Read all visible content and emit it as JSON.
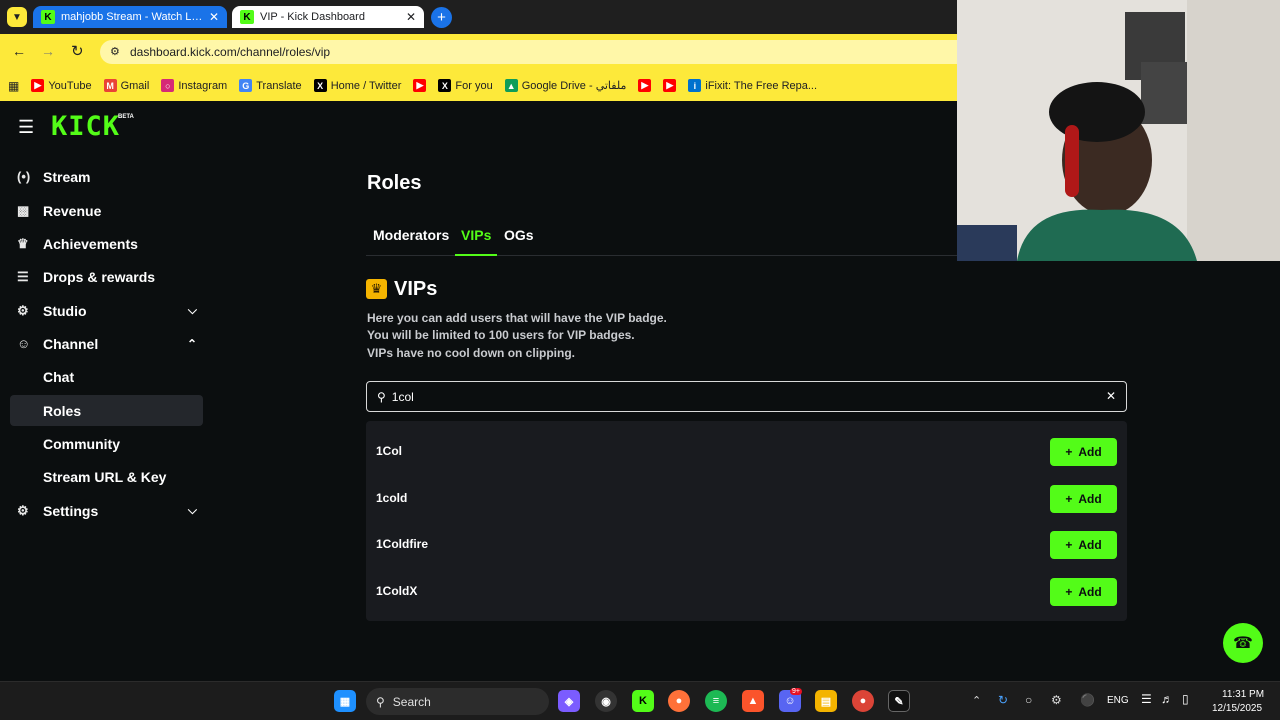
{
  "browser": {
    "tabs": [
      {
        "title": "mahjobb Stream - Watch Live o",
        "state": "inactive"
      },
      {
        "title": "VIP - Kick Dashboard",
        "state": "active"
      }
    ],
    "url": "dashboard.kick.com/channel/roles/vip",
    "bookmarks": [
      "YouTube",
      "Gmail",
      "Instagram",
      "Translate",
      "Home / Twitter",
      "For you",
      "Google Drive - ملفاتي",
      "iFixit: The Free Repa..."
    ]
  },
  "app": {
    "logo": "KICK",
    "logo_badge": "BETA",
    "sidebar": [
      {
        "label": "Stream",
        "icon": "broadcast-icon"
      },
      {
        "label": "Revenue",
        "icon": "chart-icon"
      },
      {
        "label": "Achievements",
        "icon": "trophy-icon"
      },
      {
        "label": "Drops & rewards",
        "icon": "drops-icon"
      },
      {
        "label": "Studio",
        "icon": "studio-icon"
      },
      {
        "label": "Channel",
        "icon": "users-icon"
      },
      {
        "label": "Chat"
      },
      {
        "label": "Roles"
      },
      {
        "label": "Community"
      },
      {
        "label": "Stream URL & Key"
      },
      {
        "label": "Settings",
        "icon": "gear-icon"
      }
    ],
    "page_title": "Roles",
    "role_tabs": [
      "Moderators",
      "VIPs",
      "OGs"
    ],
    "section_title": "VIPs",
    "description": [
      "Here you can add users that will have the VIP badge.",
      "You will be limited to 100 users for VIP badges.",
      "VIPs have no cool down on clipping."
    ],
    "search_value": "1col",
    "results": [
      {
        "username": "1Col",
        "action": "Add"
      },
      {
        "username": "1cold",
        "action": "Add"
      },
      {
        "username": "1Coldfire",
        "action": "Add"
      },
      {
        "username": "1ColdX",
        "action": "Add"
      }
    ],
    "accent_color": "#53fc18"
  },
  "taskbar": {
    "search_label": "Search",
    "language": "ENG",
    "time": "11:31 PM",
    "date": "12/15/2025",
    "discord_badge": "9+"
  }
}
